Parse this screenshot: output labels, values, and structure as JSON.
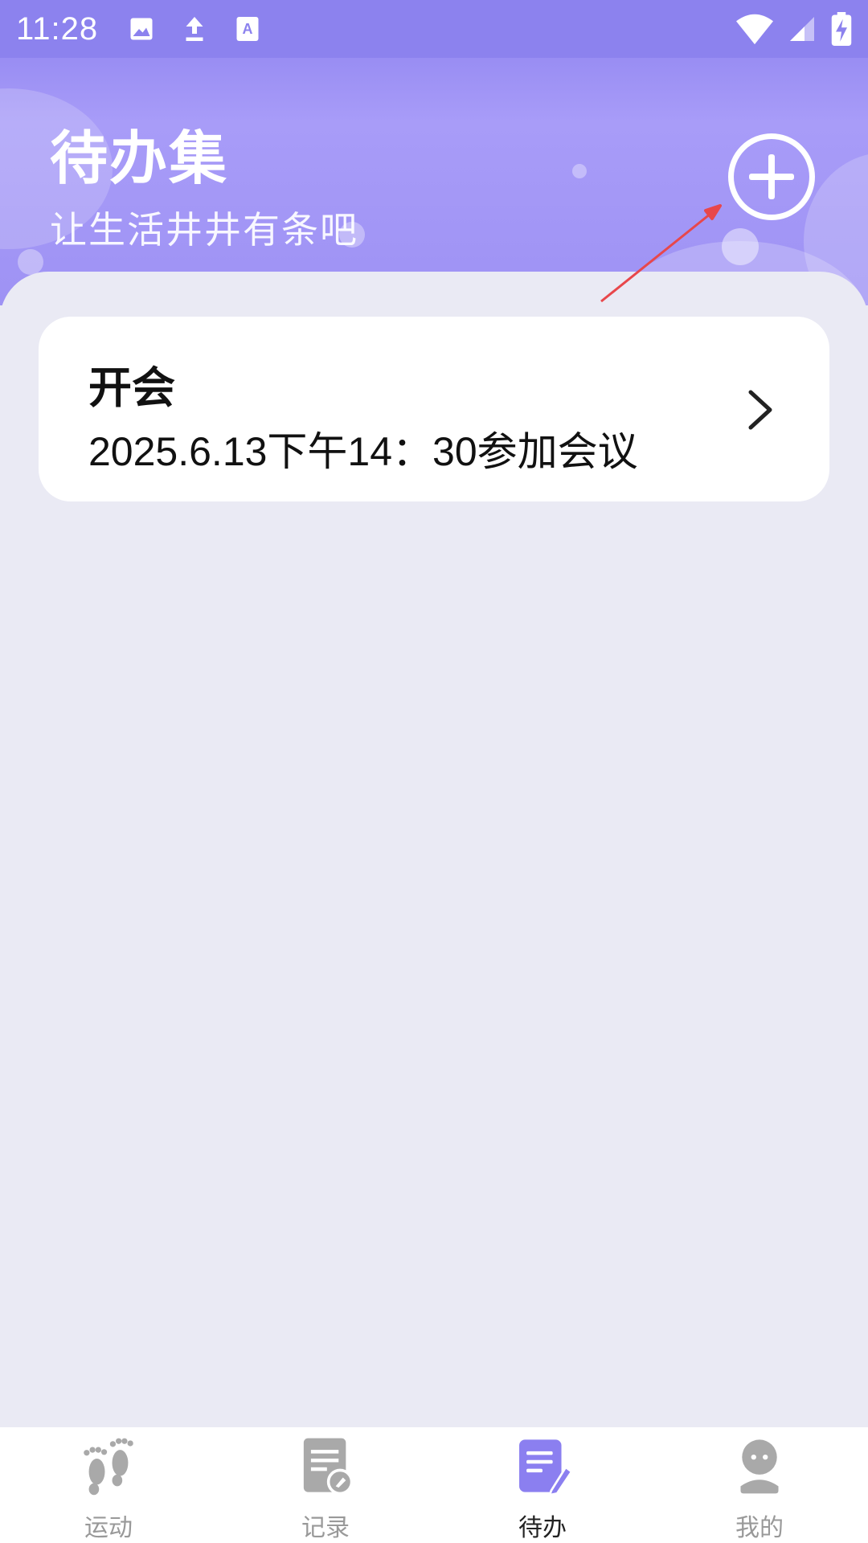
{
  "status_bar": {
    "time": "11:28",
    "icons_left": [
      "image-icon",
      "upload-icon",
      "text-icon"
    ],
    "icons_right": [
      "wifi-icon",
      "signal-icon",
      "battery-charging-icon"
    ]
  },
  "header": {
    "title": "待办集",
    "subtitle": "让生活井井有条吧",
    "add_icon": "plus-circle-icon"
  },
  "todos": [
    {
      "title": "开会",
      "description": "2025.6.13下午14：30参加会议"
    }
  ],
  "bottom_nav": [
    {
      "label": "运动",
      "icon": "footprints-icon",
      "active": false
    },
    {
      "label": "记录",
      "icon": "note-pin-icon",
      "active": false
    },
    {
      "label": "待办",
      "icon": "todo-edit-icon",
      "active": true
    },
    {
      "label": "我的",
      "icon": "profile-icon",
      "active": false
    }
  ],
  "colors": {
    "header": "#8C82EE",
    "accent": "#8B7FF0",
    "background": "#EAEAF4",
    "inactive_icon": "#A9A9A9",
    "annotation_arrow": "#E8474B"
  }
}
